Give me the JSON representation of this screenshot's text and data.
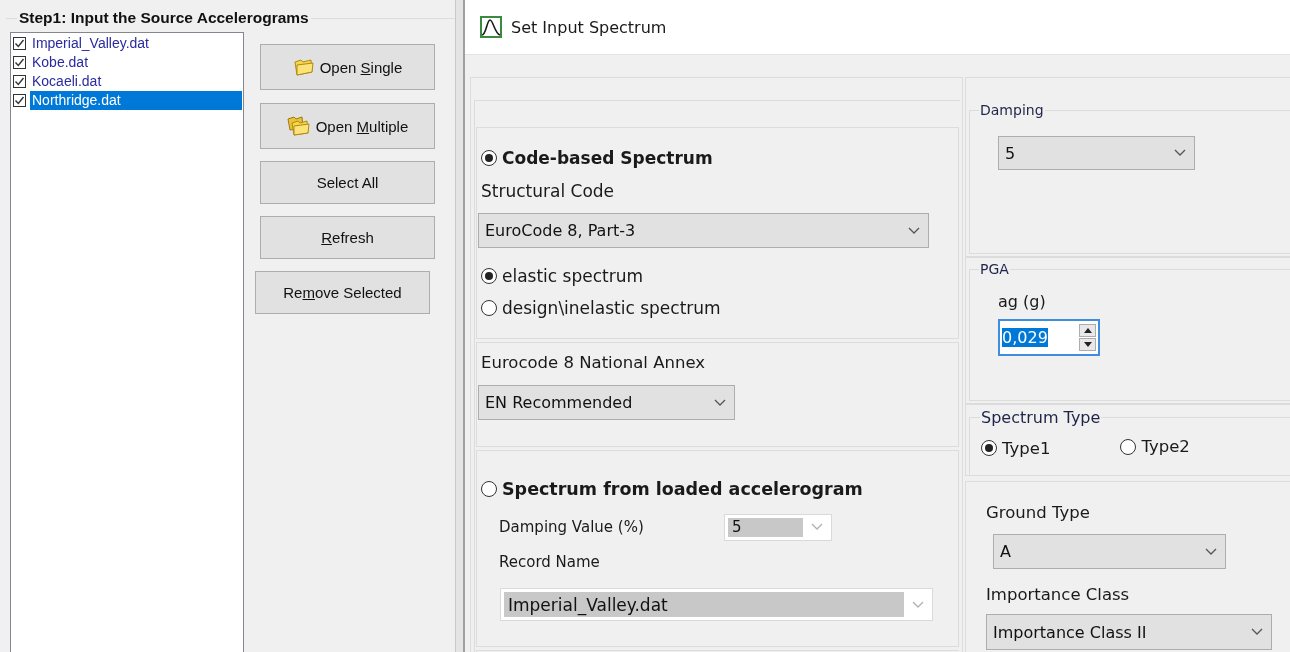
{
  "source_panel": {
    "title": "Step1: Input the Source Accelerograms",
    "files": [
      {
        "name": "Imperial_Valley.dat",
        "checked": true,
        "selected": false
      },
      {
        "name": "Kobe.dat",
        "checked": true,
        "selected": false
      },
      {
        "name": "Kocaeli.dat",
        "checked": true,
        "selected": false
      },
      {
        "name": "Northridge.dat",
        "checked": true,
        "selected": true
      }
    ],
    "buttons": [
      {
        "label": "Open Single"
      },
      {
        "label": "Open Multiple"
      },
      {
        "label": "Select All"
      },
      {
        "label": "Refresh"
      },
      {
        "label": "Remove Selected"
      }
    ]
  },
  "dialog": {
    "title": "Set Input Spectrum",
    "code_based": {
      "label": "Code-based Spectrum",
      "selected": true,
      "structural_code_label": "Structural Code",
      "structural_code": "EuroCode 8, Part-3",
      "spectrum_options": [
        {
          "label": "elastic spectrum",
          "selected": true
        },
        {
          "label": "design\\inelastic spectrum",
          "selected": false
        }
      ]
    },
    "national_annex": {
      "label": "Eurocode 8 National Annex",
      "value": "EN Recommended"
    },
    "from_accelerogram": {
      "label": "Spectrum from loaded accelerogram",
      "selected": false,
      "disabled": true,
      "damping_label": "Damping Value (%)",
      "damping_value": "5",
      "record_label": "Record Name",
      "record_value": "Imperial_Valley.dat"
    },
    "damping": {
      "title": "Damping",
      "value": "5"
    },
    "pga": {
      "title": "PGA",
      "label": "ag (g)",
      "value": "0,029"
    },
    "spectrum_type": {
      "title": "Spectrum Type",
      "options": [
        {
          "label": "Type1",
          "selected": true
        },
        {
          "label": "Type2",
          "selected": false
        }
      ]
    },
    "ground_type": {
      "label": "Ground Type",
      "value": "A"
    },
    "importance_class": {
      "label": "Importance Class",
      "value": "Importance Class II"
    }
  }
}
